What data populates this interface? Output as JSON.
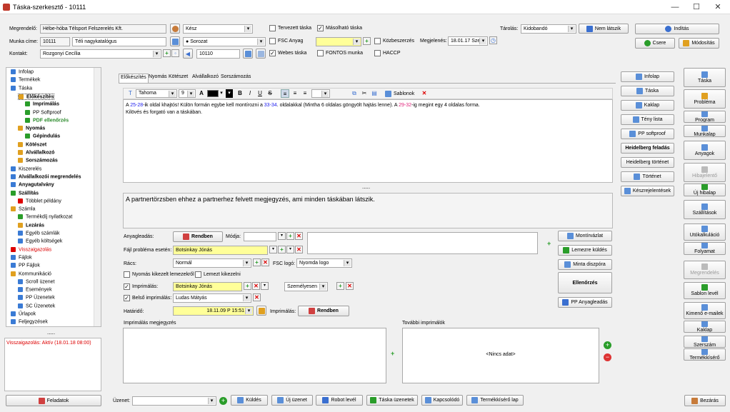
{
  "window": {
    "title": "Táska-szerkesztő - 10111",
    "min": "—",
    "max": "☐",
    "close": "✕"
  },
  "header": {
    "megrendelo_label": "Megrendelő:",
    "megrendelo": "Hébe-hóba Télsport Felszerelés Kft.",
    "munkacime_label": "Munka címe:",
    "munkacim_id": "10111",
    "munkacim": "Téli nagykatalógus",
    "kontakt_label": "Kontakt:",
    "kontakt": "Rozgonyi Cecília",
    "status": "Kész",
    "sorozat": "Sorozat",
    "code": "10110",
    "tervezett": "Tervezett táska",
    "masolhato": "Másolható táska",
    "fsc": "FSC Anyag",
    "webes": "Webes táska",
    "fontos": "FONTOS munka",
    "kozbeszerzes": "Közbeszerzés",
    "haccp": "HACCP",
    "megjelenes_label": "Megjelenés:",
    "megjelenes": "18.01.17 Sze",
    "tarolas_label": "Tárolás:",
    "tarolas": "Kidobandó",
    "nem_latszik": "Nem látszik",
    "inditas": "Indítás",
    "csere": "Csere",
    "modositas": "Módosítás"
  },
  "tree": [
    {
      "t": "Infolap",
      "l": 0,
      "c": "#3a7bd5"
    },
    {
      "t": "Termékek",
      "l": 0,
      "c": "#3a7bd5"
    },
    {
      "t": "Táska",
      "l": 0,
      "c": "#3a7bd5"
    },
    {
      "t": "Előkészítés",
      "l": 1,
      "b": true,
      "sel": true,
      "c": "#e0a020"
    },
    {
      "t": "Imprimálás",
      "l": 2,
      "b": true,
      "c": "#2a9d2a"
    },
    {
      "t": "PP Softproof",
      "l": 2,
      "c": "#2a9d2a"
    },
    {
      "t": "PDF ellenőrzés",
      "l": 2,
      "b": true,
      "g": true,
      "c": "#2a9d2a"
    },
    {
      "t": "Nyomás",
      "l": 1,
      "b": true,
      "c": "#e0a020"
    },
    {
      "t": "Gépindulás",
      "l": 2,
      "b": true,
      "c": "#2a9d2a"
    },
    {
      "t": "Kötészet",
      "l": 1,
      "b": true,
      "c": "#e0a020"
    },
    {
      "t": "Alvállalkozó",
      "l": 1,
      "b": true,
      "c": "#e0a020"
    },
    {
      "t": "Sorszámozás",
      "l": 1,
      "b": true,
      "c": "#e0a020"
    },
    {
      "t": "Kiszerelés",
      "l": 0,
      "c": "#3a7bd5"
    },
    {
      "t": "Alvállalkozói megrendelés",
      "l": 0,
      "b": true,
      "c": "#3a7bd5"
    },
    {
      "t": "Anyagutalvány",
      "l": 0,
      "b": true,
      "c": "#3a7bd5"
    },
    {
      "t": "Szállítás",
      "l": 0,
      "b": true,
      "c": "#2a9d2a"
    },
    {
      "t": "Többlet példány",
      "l": 1,
      "c": "#d00"
    },
    {
      "t": "Számla",
      "l": 0,
      "c": "#e0a020"
    },
    {
      "t": "Termékdíj nyilatkozat",
      "l": 1,
      "c": "#2a9d2a"
    },
    {
      "t": "Lezárás",
      "l": 1,
      "b": true,
      "c": "#e0a020"
    },
    {
      "t": "Egyéb számlák",
      "l": 1,
      "c": "#3a7bd5"
    },
    {
      "t": "Egyéb költségek",
      "l": 1,
      "c": "#3a7bd5"
    },
    {
      "t": "Visszaigazolás",
      "l": 0,
      "r": true,
      "c": "#d00"
    },
    {
      "t": "Fájlok",
      "l": 0,
      "c": "#3a7bd5"
    },
    {
      "t": "PP Fájlok",
      "l": 0,
      "c": "#3a7bd5"
    },
    {
      "t": "Kommunikáció",
      "l": 0,
      "c": "#e0a020"
    },
    {
      "t": "Scroll üzenet",
      "l": 1,
      "c": "#3a7bd5"
    },
    {
      "t": "Események",
      "l": 1,
      "c": "#3a7bd5"
    },
    {
      "t": "PP Üzenetek",
      "l": 1,
      "c": "#3a7bd5"
    },
    {
      "t": "SC Üzenetek",
      "l": 1,
      "c": "#3a7bd5"
    },
    {
      "t": "Űrlapok",
      "l": 0,
      "c": "#3a7bd5"
    },
    {
      "t": "Feljegyzések",
      "l": 0,
      "c": "#3a7bd5"
    }
  ],
  "tree_dots": ".....",
  "visszaig_status": "Visszaigazolás: Aktív (18.01.18 08:00)",
  "tabs": [
    "Előkészítés",
    "Nyomás",
    "Kötészet",
    "Alvállalkozó",
    "Sorszámozás"
  ],
  "editor": {
    "font": "Tahoma",
    "size": "9",
    "bold": "B",
    "italic": "I",
    "underline": "U",
    "strike": "S",
    "sablonok": "Sablonok",
    "line1_a": "A ",
    "line1_b": "25-28",
    "line1_c": "-ik oldal khajtós! Külön formán egybe kell montírozni a ",
    "line1_d": "33-34",
    "line1_e": ". oldalakkal (Mintha 6 oldalas göngyölt hajtás lenne). A ",
    "line1_f": "29-32",
    "line1_g": "-ig megint egy 4 oldalas forma.",
    "line2": "Kilövés és forgató van a táskában.",
    "dots": ".....",
    "partner_note": "A partnertörzsben ehhez a partnerhez felvett megjegyzés, ami minden táskában látszik."
  },
  "form": {
    "anyagleadas": "Anyagleadás:",
    "rendben": "Rendben",
    "modja": "Módja:",
    "fajl_problema": "Fájl probléma esetén:",
    "fajl_person": "Botsinkay Jónás",
    "racs": "Rács:",
    "racs_val": "Normál",
    "fsc_logo": "FSC logó:",
    "fsc_logo_val": "Nyomda logo",
    "nyomas_kikezelt": "Nyomás kikezelt lemezekről",
    "lemezt_kikezelni": "Lemezt kikezelni",
    "imprimalas": "Imprimálás:",
    "imprimalas_person": "Botsinkay Jónás",
    "szemelyesen": "Személyesen",
    "belso_imprimalas": "Belső imprimálás:",
    "belso_person": "Ludas Mátyás",
    "hatarido": "Határidő:",
    "hatarido_val": "18.11.09 P 15:51",
    "imprimalas2": "Imprimálás:",
    "rendben2": "Rendben",
    "megjegyzes": "Imprimálás megjegyzés",
    "tovabbi": "További imprimálók",
    "nincs": "<Nincs adat>"
  },
  "midbuttons": {
    "montirvazlat": "Montírvázlat",
    "lemezre": "Lemezre küldés",
    "minta": "Minta diszpóra",
    "ellenorzes": "Ellenőrzés",
    "pp_anyag": "PP Anyagleadás"
  },
  "rightcol": [
    "Infolap",
    "Táska",
    "Kaklap",
    "Tény lista",
    "PP softproof",
    "Heidelberg feladás",
    "Heidelberg történet",
    "Történet",
    "Készrejelentések"
  ],
  "farright": [
    "Táska",
    "Probléma",
    "Program",
    "Munkalap",
    "Anyagok",
    "Hibajelentő",
    "Új hibalap",
    "Szállítások",
    "Utókalkuláció",
    "Folyamat",
    "Megrendelés",
    "Sablon levél",
    "Kimenő e-mailek",
    "Kaklap",
    "Szerszám",
    "Termékkísérő"
  ],
  "footer": {
    "feladatok": "Feladatok",
    "uzenet": "Üzenet:",
    "kuldes": "Küldés",
    "uj_uzenet": "Új üzenet",
    "robot": "Robot levél",
    "taska_uz": "Táska üzenetek",
    "kapcsolodo": "Kapcsolódó",
    "termekkisero": "Termékkísérő lap",
    "bezaras": "Bezárás"
  },
  "colors": {
    "accent": "#1a1aee",
    "pink": "#e0207a",
    "yellow": "#ffff99"
  }
}
